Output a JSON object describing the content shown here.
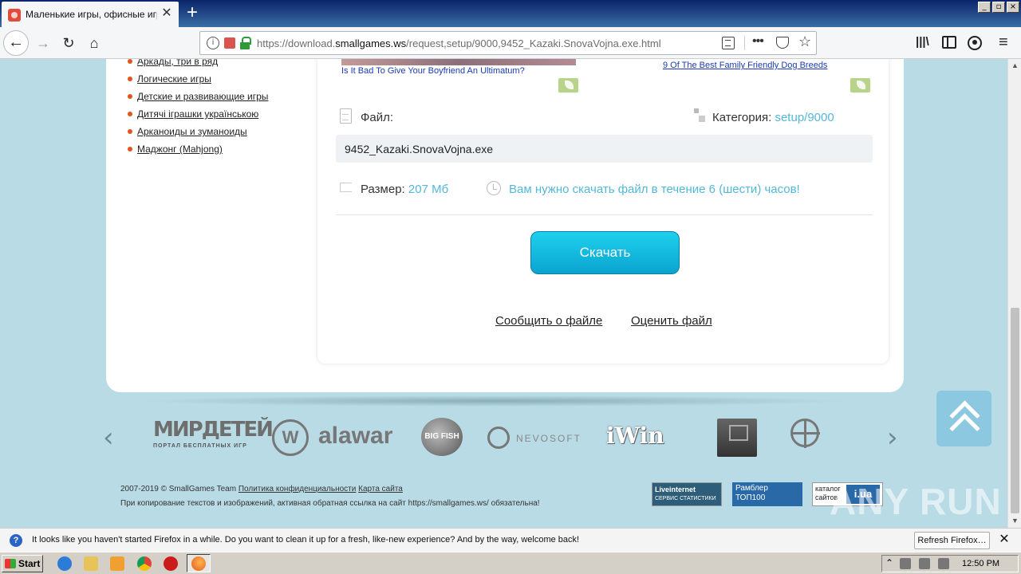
{
  "browser": {
    "tab_title": "Маленькие игры, офисные игры",
    "tab_close": "✕",
    "new_tab": "+",
    "url_prefix": "https://download.",
    "url_host": "smallgames.ws",
    "url_path": "/request,setup/9000,9452_Kazaki.SnovaVojna.exe.html",
    "win_min": "_",
    "win_max": "▫",
    "win_close": "×"
  },
  "sidebar": {
    "items": [
      {
        "label": "Аркады, три в ряд"
      },
      {
        "label": "Логические игры"
      },
      {
        "label": "Детские и развивающие игры"
      },
      {
        "label": "Дитячі іграшки українською"
      },
      {
        "label": "Арканоиды и зуманоиды"
      },
      {
        "label": "Маджонг (Mahjong)"
      }
    ]
  },
  "ads": {
    "link1": "Is It Bad To Give Your Boyfriend An Ultimatum?",
    "link2": "9 Of The Best Family Friendly Dog Breeds"
  },
  "file": {
    "file_label": "Файл:",
    "category_label": "Категория:",
    "category_value": "setup/9000",
    "filename": "9452_Kazaki.SnovaVojna.exe",
    "size_label": "Размер:",
    "size_value": "207 Мб",
    "notice": "Вам нужно скачать файл в течение 6 (шести) часов!",
    "download_button": "Скачать",
    "report_link": "Сообщить о файле",
    "rate_link": "Оценить файл"
  },
  "partners": {
    "mir_big": "МИРДЕТЕЙ",
    "mir_small": "ПОРТАЛ БЕСПЛАТНЫХ ИГР",
    "alawar": "alawar",
    "alawar_letter": "W",
    "bigfish": "BIG FISH",
    "nevosoft": "NEVOSOFT",
    "iwin": "iWin"
  },
  "footer": {
    "copyright": "2007-2019 © SmallGames Team",
    "privacy_link": "Политика конфиденциальности",
    "sitemap_link": "Карта сайта",
    "note": "При копирование текстов и изображений, активная обратная ссылка на сайт https://smallgames.ws/ обязательна!",
    "badge_li_1": "Liveinternet",
    "badge_li_2": "СЕРВИС СТАТИСТИКИ",
    "badge_ramb_1": "Рамблер",
    "badge_ramb_2": "ТОП100",
    "badge_ua_1": "каталог",
    "badge_ua_2": "сайтов",
    "badge_ua_logo": "i.ua",
    "watermark": "ANY RUN"
  },
  "notification": {
    "text": "It looks like you haven't started Firefox in a while. Do you want to clean it up for a fresh, like-new experience? And by the way, welcome back!",
    "button": "Refresh Firefox…",
    "close": "✕"
  },
  "taskbar": {
    "start": "Start",
    "time": "12:50 PM"
  }
}
